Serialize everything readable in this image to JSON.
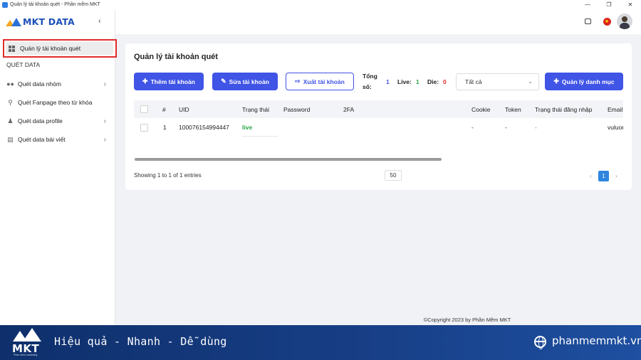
{
  "window": {
    "title": "Quản lý tài khoản quét - Phần mềm MKT",
    "minimize": "—",
    "maximize": "❐",
    "close": "✕"
  },
  "sidebar": {
    "logo_text": "MKT DATA",
    "collapse": "‹",
    "active_item": "Quản lý tài khoản quét",
    "section_label": "QUÉT DATA",
    "items": [
      {
        "label": "Quét data nhóm",
        "icon": "users-icon",
        "has_chevron": true
      },
      {
        "label": "Quét Fanpage theo từ khóa",
        "icon": "search-icon",
        "has_chevron": false
      },
      {
        "label": "Quét data profile",
        "icon": "user-tie-icon",
        "has_chevron": true
      },
      {
        "label": "Quét data bài viết",
        "icon": "document-icon",
        "has_chevron": true
      }
    ]
  },
  "topbar": {
    "flag_icon": "vietnam-flag-icon",
    "flag_star": "★"
  },
  "main": {
    "title": "Quản lý tài khoản quét",
    "buttons": {
      "add": "Thêm tài khoản",
      "edit": "Sửa tài khoản",
      "export": "Xuất tài khoản",
      "manage": "Quản lý danh mục"
    },
    "stats": {
      "total_label_1": "Tổng",
      "total_label_2": "số:",
      "total_value": "1",
      "live_label": "Live:",
      "live_value": "1",
      "die_label": "Die:",
      "die_value": "0"
    },
    "filter": {
      "selected": "Tất cả"
    },
    "colors": {
      "accent": "#4054e6",
      "live": "#27a844",
      "die": "#e02b2b",
      "highlight": "#e02b2b"
    },
    "table": {
      "headers": [
        "#",
        "UID",
        "Trạng thái",
        "Password",
        "2FA",
        "Cookie",
        "Token",
        "Trạng thái đăng nhập",
        "Email"
      ],
      "rows": [
        {
          "index": "1",
          "uid": "100076154994447",
          "status": "live",
          "password": "",
          "twofa": "",
          "cookie": "-",
          "token": "-",
          "login_status": "-",
          "email": "vuluon"
        }
      ]
    },
    "footer": {
      "showing": "Showing 1 to 1 of 1 entries",
      "page_size": "50",
      "prev": "‹",
      "current_page": "1",
      "next": "›"
    }
  },
  "copyright": "©Copyright 2023 by Phần Mềm MKT",
  "banner": {
    "logo_text": "MKT",
    "logo_sub": "Phần mềm marketing",
    "slogan": "Hiệu quả - Nhanh  - Dễ dùng",
    "website": "phanmemmkt.vn"
  }
}
